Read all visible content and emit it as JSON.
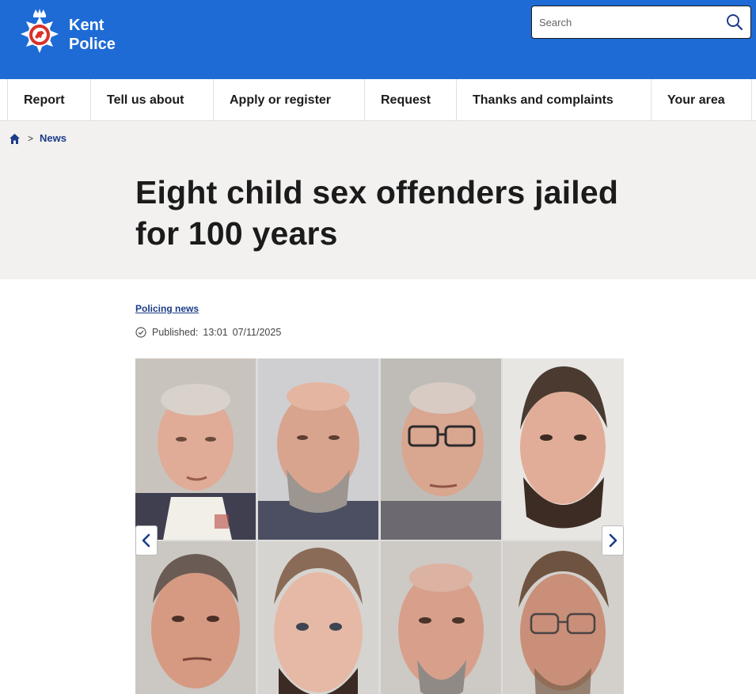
{
  "brand": {
    "line1": "Kent",
    "line2": "Police"
  },
  "search": {
    "placeholder": "Search"
  },
  "nav": {
    "items": [
      {
        "label": "Report"
      },
      {
        "label": "Tell us about"
      },
      {
        "label": "Apply or register"
      },
      {
        "label": "Request"
      },
      {
        "label": "Thanks and complaints"
      },
      {
        "label": "Your area"
      }
    ]
  },
  "breadcrumb": {
    "separator": ">",
    "current": "News"
  },
  "article": {
    "title": "Eight child sex offenders jailed for 100 years",
    "category": "Policing news",
    "published_label": "Published:",
    "published_time": "13:01",
    "published_date": "07/11/2025"
  },
  "gallery": {
    "photos": [
      {
        "name": "mugshot-1"
      },
      {
        "name": "mugshot-2"
      },
      {
        "name": "mugshot-3"
      },
      {
        "name": "mugshot-4"
      },
      {
        "name": "mugshot-5"
      },
      {
        "name": "mugshot-6"
      },
      {
        "name": "mugshot-7"
      },
      {
        "name": "mugshot-8"
      }
    ]
  },
  "colors": {
    "header_blue": "#1e6bd6",
    "link_blue": "#1b3c87",
    "band_grey": "#f2f1f0"
  },
  "icons": {
    "home": "home-icon",
    "search": "search-icon",
    "published": "check-circle-icon",
    "prev": "chevron-left-icon",
    "next": "chevron-right-icon"
  }
}
